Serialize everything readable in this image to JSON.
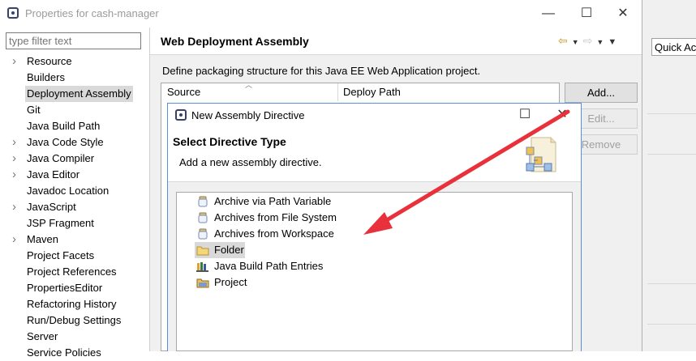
{
  "background": {
    "quick_access": "Quick Ac"
  },
  "window": {
    "title": "Properties for cash-manager",
    "minimize": "—",
    "maximize": "☐",
    "close": "✕"
  },
  "sidebar": {
    "filter_placeholder": "type filter text",
    "items": [
      {
        "label": "Resource",
        "expandable": true
      },
      {
        "label": "Builders",
        "expandable": false
      },
      {
        "label": "Deployment Assembly",
        "expandable": false,
        "selected": true
      },
      {
        "label": "Git",
        "expandable": false
      },
      {
        "label": "Java Build Path",
        "expandable": false
      },
      {
        "label": "Java Code Style",
        "expandable": true
      },
      {
        "label": "Java Compiler",
        "expandable": true
      },
      {
        "label": "Java Editor",
        "expandable": true
      },
      {
        "label": "Javadoc Location",
        "expandable": false
      },
      {
        "label": "JavaScript",
        "expandable": true
      },
      {
        "label": "JSP Fragment",
        "expandable": false
      },
      {
        "label": "Maven",
        "expandable": true
      },
      {
        "label": "Project Facets",
        "expandable": false
      },
      {
        "label": "Project References",
        "expandable": false
      },
      {
        "label": "PropertiesEditor",
        "expandable": false
      },
      {
        "label": "Refactoring History",
        "expandable": false
      },
      {
        "label": "Run/Debug Settings",
        "expandable": false
      },
      {
        "label": "Server",
        "expandable": false
      },
      {
        "label": "Service Policies",
        "expandable": false
      }
    ]
  },
  "page": {
    "title": "Web Deployment Assembly",
    "description": "Define packaging structure for this Java EE Web Application project.",
    "columns": [
      "Source",
      "Deploy Path"
    ],
    "buttons": {
      "add": "Add...",
      "edit": "Edit...",
      "remove": "Remove"
    }
  },
  "dialog": {
    "title": "New Assembly Directive",
    "heading": "Select Directive Type",
    "description": "Add a new assembly directive.",
    "items": [
      {
        "label": "Archive via Path Variable",
        "icon": "jar-icon"
      },
      {
        "label": "Archives from File System",
        "icon": "jar-icon"
      },
      {
        "label": "Archives from Workspace",
        "icon": "jar-icon"
      },
      {
        "label": "Folder",
        "icon": "folder-icon",
        "selected": true
      },
      {
        "label": "Java Build Path Entries",
        "icon": "library-icon"
      },
      {
        "label": "Project",
        "icon": "project-icon"
      }
    ]
  },
  "colors": {
    "annotation_arrow": "#e8313a",
    "selection": "#d9d9d9",
    "dialog_border": "#5a8fd6"
  }
}
